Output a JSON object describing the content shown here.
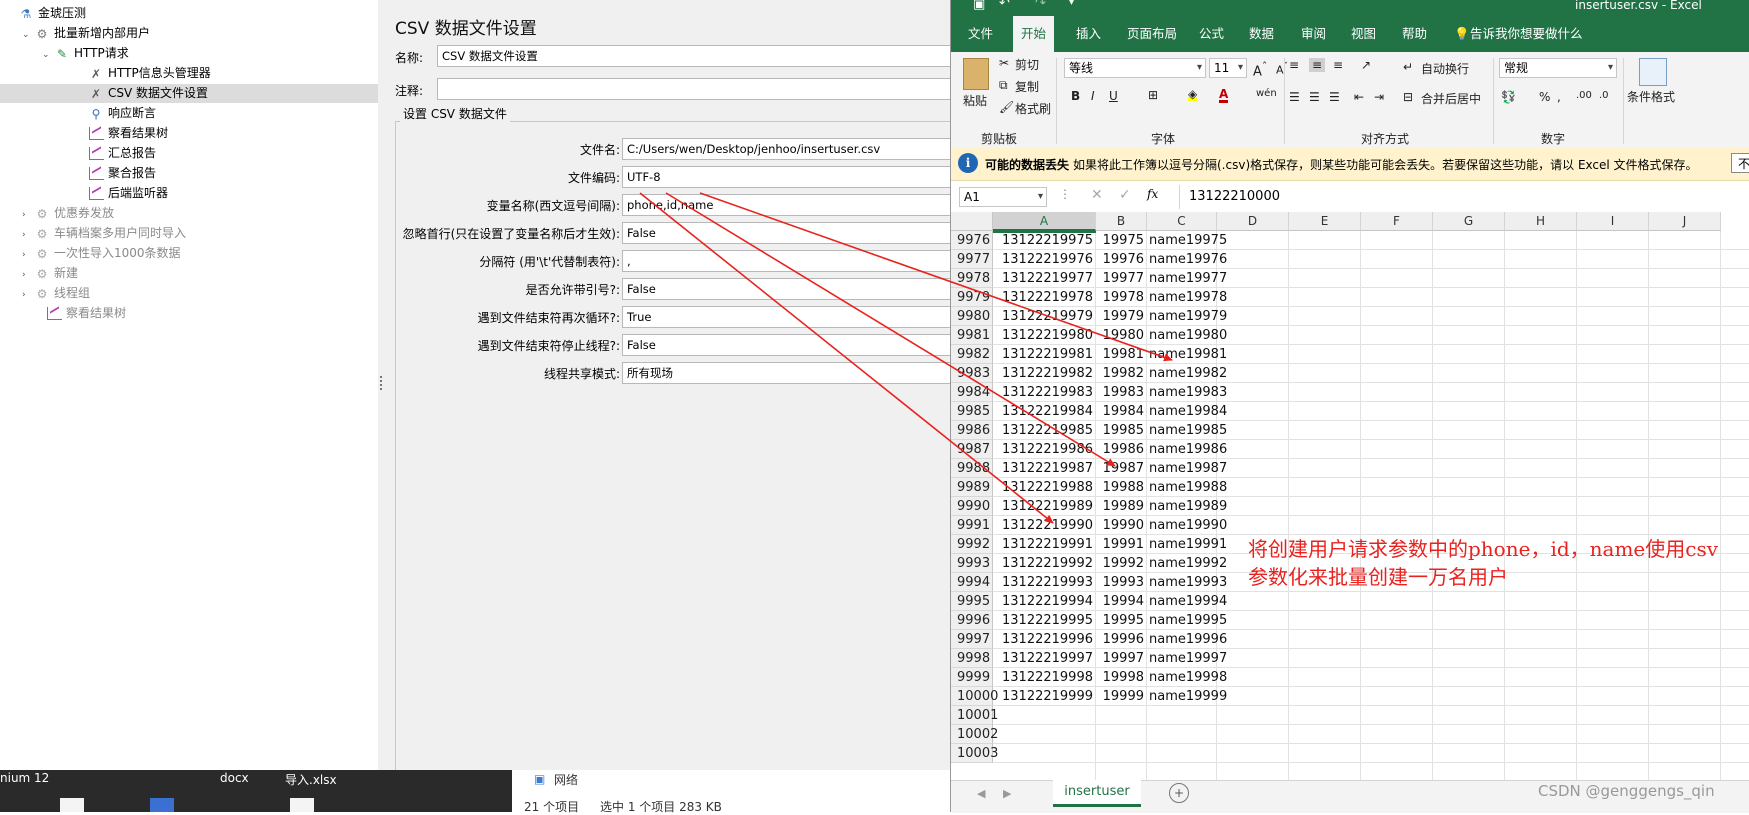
{
  "tree": {
    "items": [
      {
        "label": "金琥压测",
        "icon": "flask-icon"
      },
      {
        "label": "批量新增内部用户",
        "icon": "gear-icon"
      },
      {
        "label": "HTTP请求",
        "icon": "pipette-icon"
      },
      {
        "label": "HTTP信息头管理器",
        "icon": "wrench-icon"
      },
      {
        "label": "CSV 数据文件设置",
        "icon": "wrench-icon"
      },
      {
        "label": "响应断言",
        "icon": "magnifier-icon"
      },
      {
        "label": "察看结果树",
        "icon": "chart-icon"
      },
      {
        "label": "汇总报告",
        "icon": "chart-icon"
      },
      {
        "label": "聚合报告",
        "icon": "chart-icon"
      },
      {
        "label": "后端监听器",
        "icon": "chart-icon"
      },
      {
        "label": "优惠券发放",
        "icon": "gear-icon"
      },
      {
        "label": "车辆档案多用户同时导入",
        "icon": "gear-icon"
      },
      {
        "label": "一次性导入1000条数据",
        "icon": "gear-icon"
      },
      {
        "label": "新建",
        "icon": "gear-icon"
      },
      {
        "label": "线程组",
        "icon": "gear-icon"
      },
      {
        "label": "察看结果树",
        "icon": "chart-icon"
      }
    ]
  },
  "csv_panel": {
    "title": "CSV 数据文件设置",
    "name_label": "名称:",
    "name_value": "CSV 数据文件设置",
    "comment_label": "注释:",
    "comment_value": "",
    "group_title": "设置 CSV 数据文件",
    "fields": [
      {
        "label": "文件名:",
        "value": "C:/Users/wen/Desktop/jenhoo/insertuser.csv"
      },
      {
        "label": "文件编码:",
        "value": "UTF-8"
      },
      {
        "label": "变量名称(西文逗号间隔):",
        "value": "phone,id,name"
      },
      {
        "label": "忽略首行(只在设置了变量名称后才生效):",
        "value": "False"
      },
      {
        "label": "分隔符 (用'\\t'代替制表符):",
        "value": ","
      },
      {
        "label": "是否允许带引号?:",
        "value": "False"
      },
      {
        "label": "遇到文件结束符再次循环?:",
        "value": "True"
      },
      {
        "label": "遇到文件结束符停止线程?:",
        "value": "False"
      },
      {
        "label": "线程共享模式:",
        "value": "所有现场"
      }
    ]
  },
  "taskbar": {
    "items": [
      "nium 12",
      "docx",
      "导入.xlsx"
    ],
    "explorer_nav": "网络",
    "explorer_status": [
      "21 个项目",
      "选中 1 个项目  283 KB"
    ]
  },
  "excel": {
    "title": "insertuser.csv  -  Excel",
    "tabs": [
      "文件",
      "开始",
      "插入",
      "页面布局",
      "公式",
      "数据",
      "审阅",
      "视图",
      "帮助",
      "告诉我你想要做什么"
    ],
    "active_tab": "开始",
    "ribbon": {
      "paste": "粘贴",
      "cut": "剪切",
      "copy": "复制",
      "format_painter": "格式刷",
      "clipboard_group": "剪贴板",
      "font_name": "等线",
      "font_size": "11",
      "font_group": "字体",
      "wrap_text": "自动换行",
      "merge_center": "合并后居中",
      "alignment_group": "对齐方式",
      "number_format": "常规",
      "number_group": "数字",
      "conditional_format": "条件格式"
    },
    "message_bar": {
      "title": "可能的数据丢失",
      "text": "如果将此工作簿以逗号分隔(.csv)格式保存，则某些功能可能会丢失。若要保留这些功能，请以 Excel 文件格式保存。",
      "button": "不"
    },
    "name_box": "A1",
    "formula_value": "13122210000",
    "columns": [
      "A",
      "B",
      "C",
      "D",
      "E",
      "F",
      "G",
      "H",
      "I",
      "J"
    ],
    "rows": [
      [
        "9976",
        "13122219975",
        "19975",
        "name19975"
      ],
      [
        "9977",
        "13122219976",
        "19976",
        "name19976"
      ],
      [
        "9978",
        "13122219977",
        "19977",
        "name19977"
      ],
      [
        "9979",
        "13122219978",
        "19978",
        "name19978"
      ],
      [
        "9980",
        "13122219979",
        "19979",
        "name19979"
      ],
      [
        "9981",
        "13122219980",
        "19980",
        "name19980"
      ],
      [
        "9982",
        "13122219981",
        "19981",
        "name19981"
      ],
      [
        "9983",
        "13122219982",
        "19982",
        "name19982"
      ],
      [
        "9984",
        "13122219983",
        "19983",
        "name19983"
      ],
      [
        "9985",
        "13122219984",
        "19984",
        "name19984"
      ],
      [
        "9986",
        "13122219985",
        "19985",
        "name19985"
      ],
      [
        "9987",
        "13122219986",
        "19986",
        "name19986"
      ],
      [
        "9988",
        "13122219987",
        "19987",
        "name19987"
      ],
      [
        "9989",
        "13122219988",
        "19988",
        "name19988"
      ],
      [
        "9990",
        "13122219989",
        "19989",
        "name19989"
      ],
      [
        "9991",
        "13122219990",
        "19990",
        "name19990"
      ],
      [
        "9992",
        "13122219991",
        "19991",
        "name19991"
      ],
      [
        "9993",
        "13122219992",
        "19992",
        "name19992"
      ],
      [
        "9994",
        "13122219993",
        "19993",
        "name19993"
      ],
      [
        "9995",
        "13122219994",
        "19994",
        "name19994"
      ],
      [
        "9996",
        "13122219995",
        "19995",
        "name19995"
      ],
      [
        "9997",
        "13122219996",
        "19996",
        "name19996"
      ],
      [
        "9998",
        "13122219997",
        "19997",
        "name19997"
      ],
      [
        "9999",
        "13122219998",
        "19998",
        "name19998"
      ],
      [
        "10000",
        "13122219999",
        "19999",
        "name19999"
      ],
      [
        "10001",
        "",
        "",
        ""
      ],
      [
        "10002",
        "",
        "",
        ""
      ],
      [
        "10003",
        "",
        "",
        ""
      ]
    ],
    "sheet_tab": "insertuser"
  },
  "annotation": {
    "text": "将创建用户请求参数中的phone，id，name使用csv参数化来批量创建一万名用户",
    "color": "#e8231f"
  },
  "watermark": "CSDN @genggengs_qin"
}
